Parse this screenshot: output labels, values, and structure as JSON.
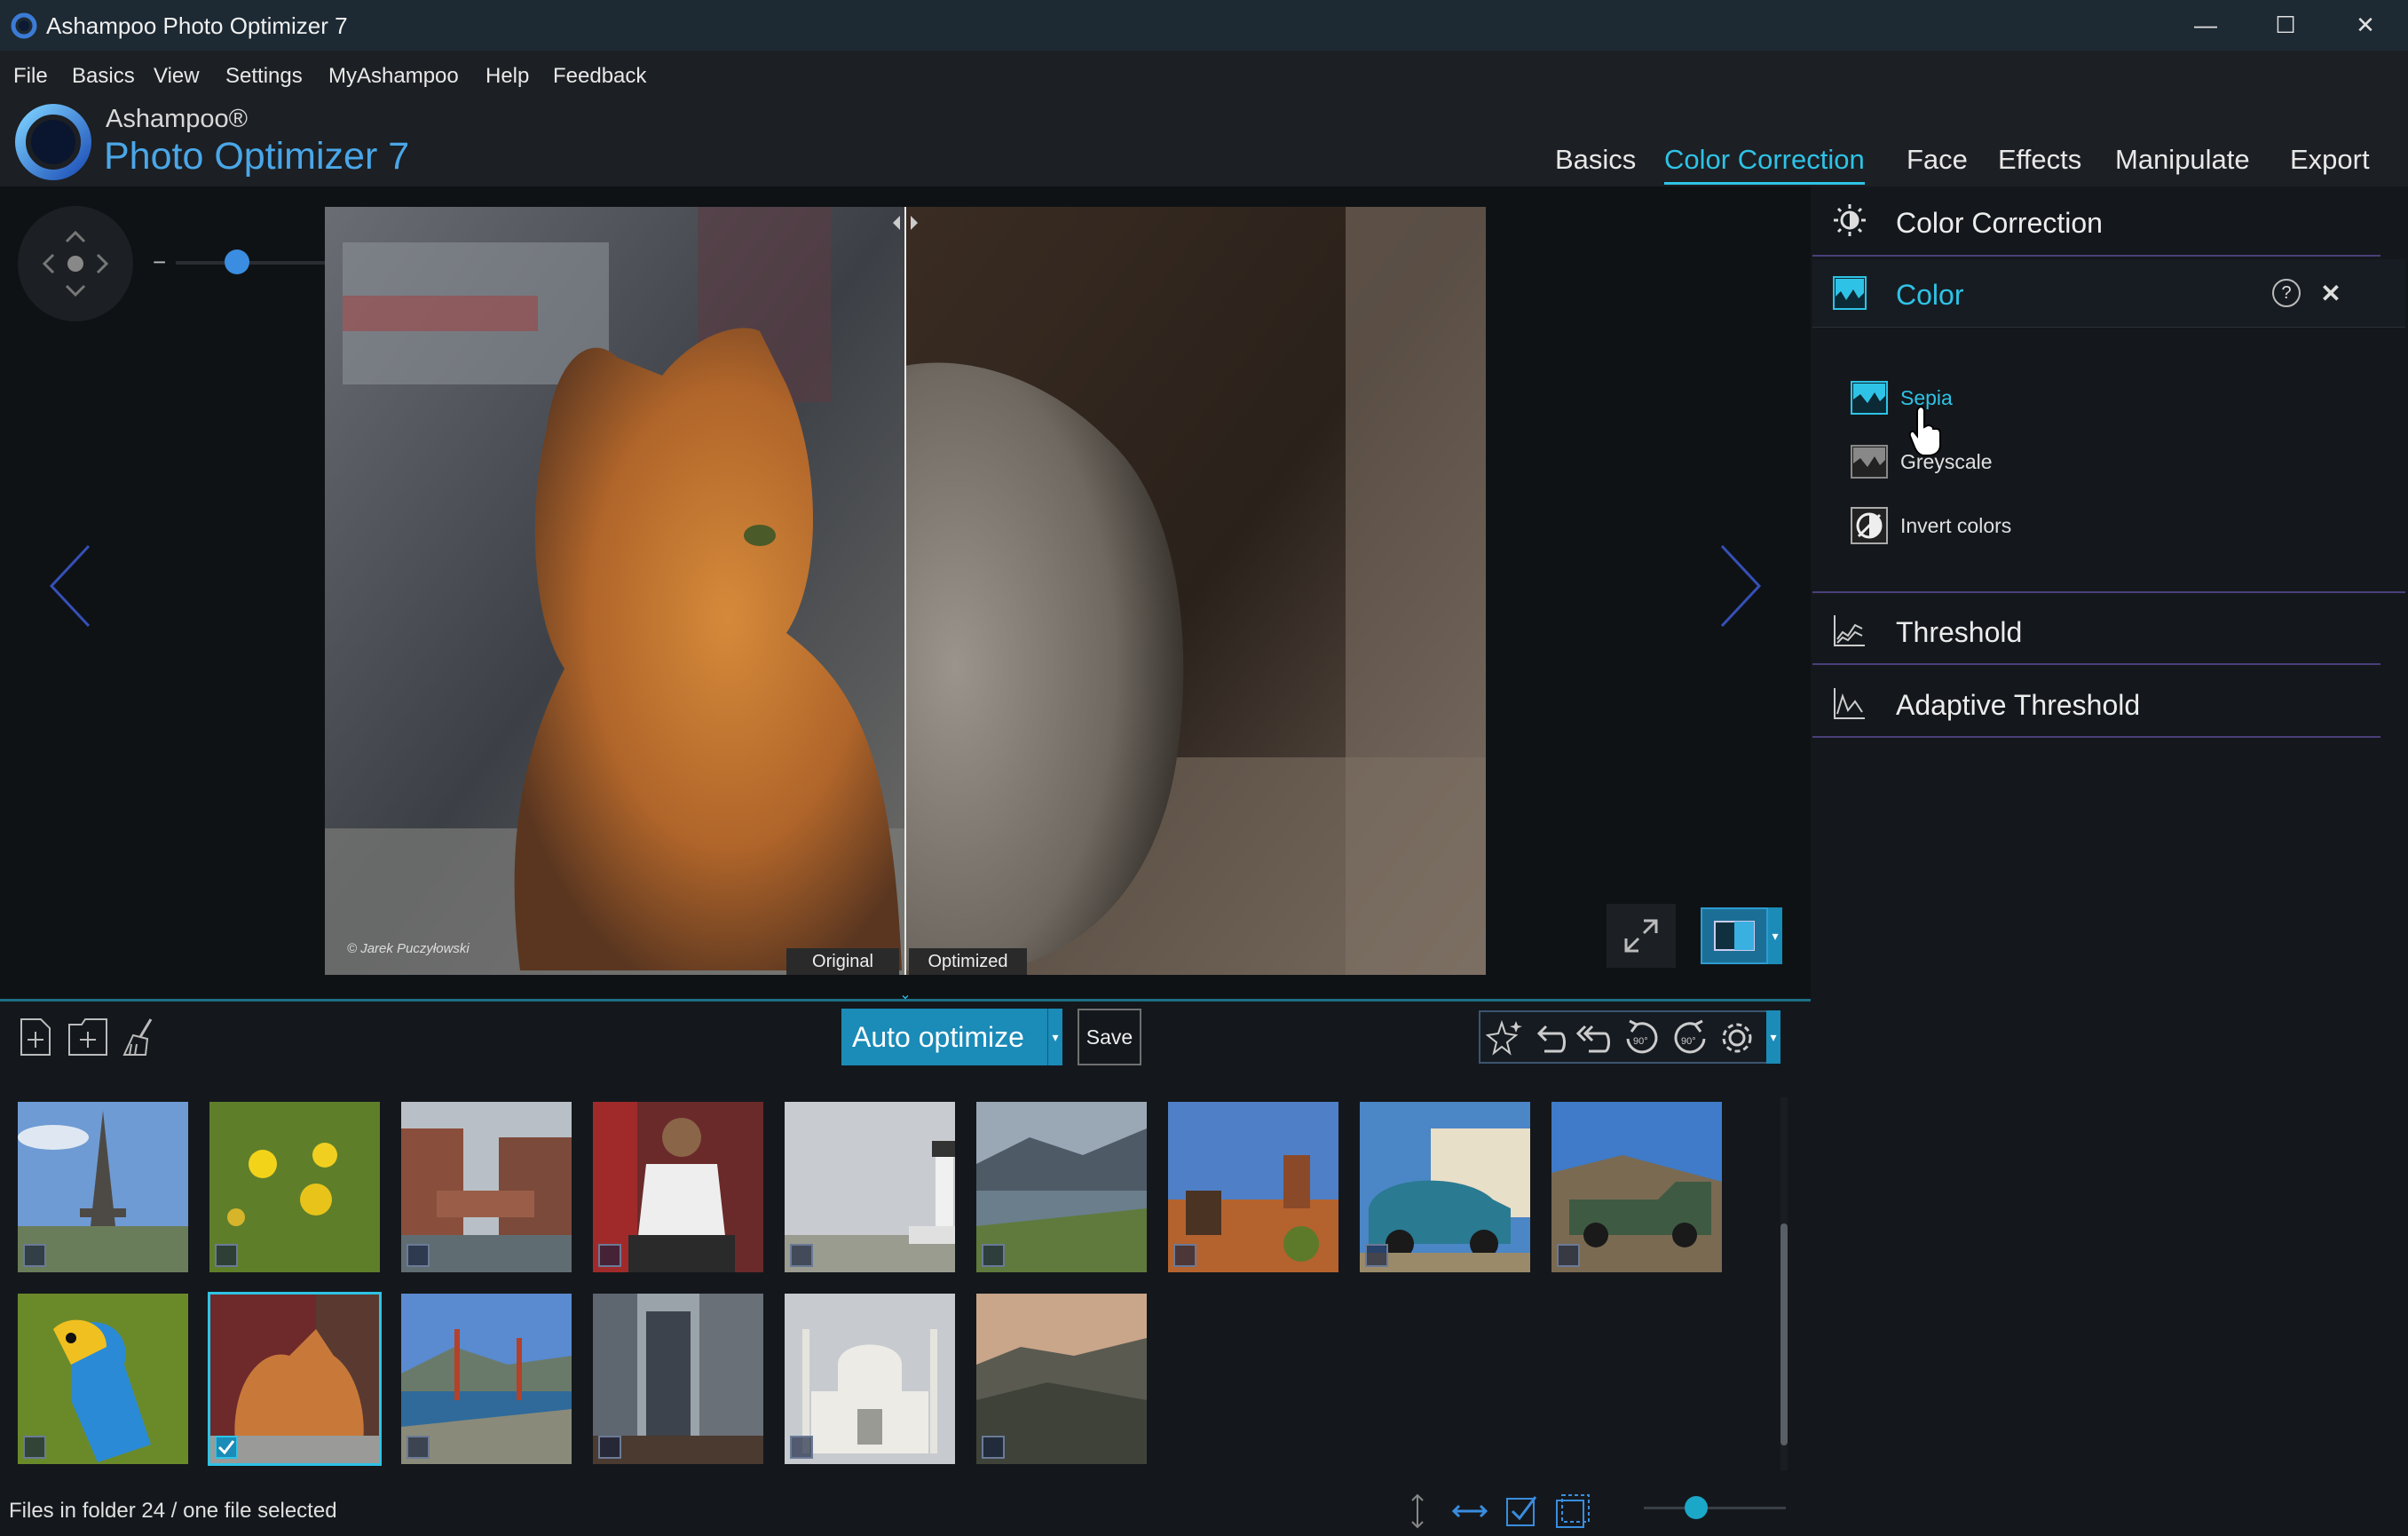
{
  "window": {
    "title": "Ashampoo Photo Optimizer 7",
    "minimize": "—",
    "maximize": "☐",
    "close": "✕"
  },
  "menu": [
    "File",
    "Basics",
    "View",
    "Settings",
    "MyAshampoo",
    "Help",
    "Feedback"
  ],
  "logo": {
    "brand": "Ashampoo®",
    "product": "Photo Optimizer 7"
  },
  "nav_tabs": [
    "Basics",
    "Color Correction",
    "Face",
    "Effects",
    "Manipulate",
    "Export"
  ],
  "active_tab": "Color Correction",
  "viewer": {
    "watermark": "© Jarek Puczyłowski",
    "label_original": "Original",
    "label_optimized": "Optimized",
    "zoom_minus": "−",
    "zoom_plus": "+"
  },
  "panel": {
    "section_title": "Color Correction",
    "color_header": "Color",
    "help": "?",
    "close": "✕",
    "color_items": [
      "Sepia",
      "Greyscale",
      "Invert colors"
    ],
    "threshold": "Threshold",
    "adaptive_threshold": "Adaptive Threshold"
  },
  "toolbar": {
    "auto_optimize": "Auto optimize",
    "save": "Save"
  },
  "thumbnails": [
    {
      "name": "eiffel-tower",
      "checked": false
    },
    {
      "name": "yellow-flowers",
      "checked": false
    },
    {
      "name": "canal-buildings",
      "checked": false
    },
    {
      "name": "man-sewing",
      "checked": false
    },
    {
      "name": "lighthouse",
      "checked": false
    },
    {
      "name": "coast-town",
      "checked": false
    },
    {
      "name": "desert-horse",
      "checked": false
    },
    {
      "name": "blue-car",
      "checked": false
    },
    {
      "name": "old-truck",
      "checked": false
    },
    {
      "name": "parrot",
      "checked": false
    },
    {
      "name": "cat",
      "checked": true
    },
    {
      "name": "golden-gate",
      "checked": false
    },
    {
      "name": "city-buildings",
      "checked": false
    },
    {
      "name": "taj-mahal",
      "checked": false
    },
    {
      "name": "mountains",
      "checked": false
    }
  ],
  "status": {
    "text": "Files in folder 24 / one file selected"
  },
  "colors": {
    "accent": "#2ec3e6",
    "background": "#14181c",
    "titlebar": "#1d2933",
    "divider": "#4a3f7a"
  }
}
